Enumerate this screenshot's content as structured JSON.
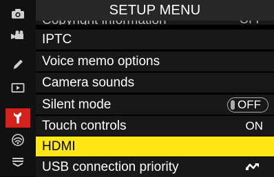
{
  "header": {
    "title": "SETUP MENU"
  },
  "tabs": [
    {
      "icon": "camera-icon",
      "active": false
    },
    {
      "icon": "movie-icon",
      "active": false
    },
    {
      "icon": "pencil-icon",
      "active": false
    },
    {
      "icon": "playback-icon",
      "active": false
    },
    {
      "icon": "wrench-icon",
      "active": true
    },
    {
      "icon": "network-icon",
      "active": false
    },
    {
      "icon": "my-menu-icon",
      "active": false
    }
  ],
  "items": {
    "copyright": {
      "label": "Copyright information",
      "value": "OFF"
    },
    "iptc": {
      "label": "IPTC"
    },
    "voice_memo": {
      "label": "Voice memo options"
    },
    "camera_sounds": {
      "label": "Camera sounds"
    },
    "silent_mode": {
      "label": "Silent mode",
      "value": "OFF"
    },
    "touch_controls": {
      "label": "Touch controls",
      "value": "ON"
    },
    "hdmi": {
      "label": "HDMI"
    },
    "usb_priority": {
      "label": "USB connection priority",
      "value_icon": "usb-icon"
    }
  },
  "colors": {
    "selected": "#ffe614",
    "active_tab": "#d6221b",
    "header": "#272727",
    "row": "#181818"
  }
}
